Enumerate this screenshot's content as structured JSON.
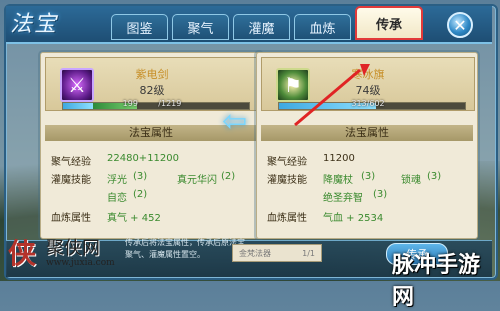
{
  "title": "法宝",
  "tabs": [
    "图鉴",
    "聚气",
    "灌魔",
    "血炼",
    "传承"
  ],
  "active_tab": "传承",
  "left": {
    "item_name": "紫电剑",
    "level": "82级",
    "exp_left": "199",
    "exp_right": "1219",
    "exp_fraction": 0.16,
    "exp_bonus_fraction": 0.4,
    "section_title": "法宝属性",
    "rows": [
      {
        "label": "聚气经验",
        "value": "22480+11200"
      },
      {
        "label": "灌魔技能",
        "v1": "浮光",
        "c1": "(3)",
        "v2": "真元华闪",
        "c2": "(2)"
      },
      {
        "label": "",
        "v1": "自恋",
        "c1": "(2)"
      },
      {
        "label": "血炼属性",
        "v1": "真气 + 452"
      }
    ]
  },
  "right": {
    "item_name": "寒冰旗",
    "level": "74级",
    "exp_text": "313/602",
    "exp_fraction": 0.52,
    "section_title": "法宝属性",
    "rows": [
      {
        "label": "聚气经验",
        "value": "11200"
      },
      {
        "label": "灌魔技能",
        "v1": "降魔杖",
        "c1": "(3)",
        "v2": "锁魂",
        "c2": "(3)"
      },
      {
        "label": "",
        "v1": "绝圣弃智",
        "c1": "(3)"
      },
      {
        "label": "血炼属性",
        "v1": "气血 + 2534"
      }
    ]
  },
  "bottom": {
    "hint": "传承后将法宝属性，传承后原法宝聚气、灌魔属性置空。",
    "select_label": "金梵法器",
    "select_count": "1/1",
    "confirm_label": "传承"
  },
  "watermark_left": {
    "big": "侠",
    "mid": "聚侠网",
    "url": "www.juxia.com"
  },
  "watermark_right": "脉冲手游网",
  "colors": {
    "accent": "#2c6a98",
    "highlight": "#e23a3a",
    "gold_text": "#c7902a",
    "green_value": "#3a8a2e"
  }
}
